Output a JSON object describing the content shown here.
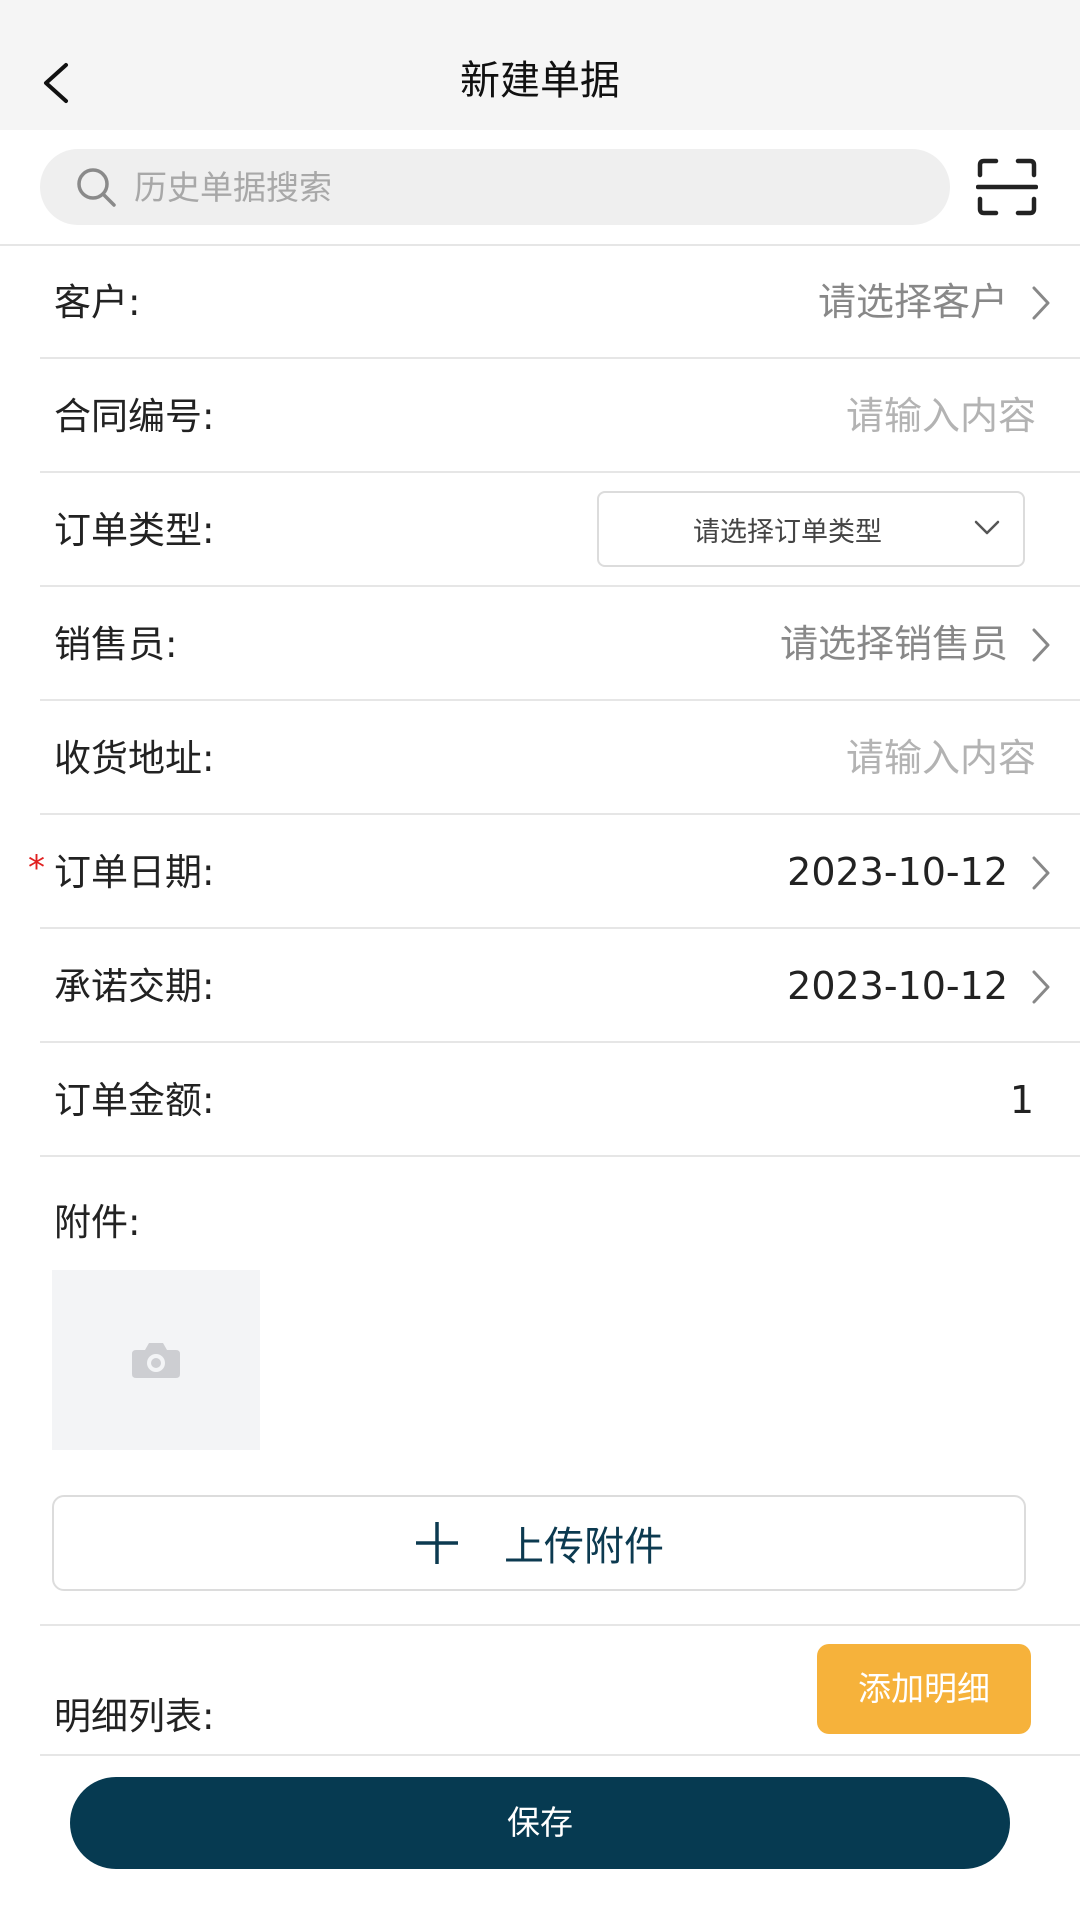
{
  "header": {
    "title": "新建单据",
    "back_icon": "chevron-left-icon"
  },
  "search": {
    "placeholder": "历史单据搜索",
    "search_icon": "search-icon",
    "scan_icon": "scan-icon"
  },
  "form": {
    "customer": {
      "label": "客户:",
      "value": "请选择客户"
    },
    "contract_no": {
      "label": "合同编号:",
      "placeholder": "请输入内容"
    },
    "order_type": {
      "label": "订单类型:",
      "select_value": "请选择订单类型"
    },
    "salesperson": {
      "label": "销售员:",
      "value": "请选择销售员"
    },
    "address": {
      "label": "收货地址:",
      "placeholder": "请输入内容"
    },
    "order_date": {
      "required_mark": "*",
      "label": "订单日期:",
      "value": "2023-10-12"
    },
    "delivery_date": {
      "label": "承诺交期:",
      "value": "2023-10-12"
    },
    "order_amount": {
      "label": "订单金额:",
      "value": "1"
    }
  },
  "attachments": {
    "label": "附件:",
    "upload_label": "上传附件"
  },
  "details": {
    "label": "明细列表:",
    "add_label": "添加明细"
  },
  "footer": {
    "save_label": "保存"
  },
  "colors": {
    "primary": "#063a51",
    "accent": "#f6b23b",
    "required": "#e02020"
  }
}
